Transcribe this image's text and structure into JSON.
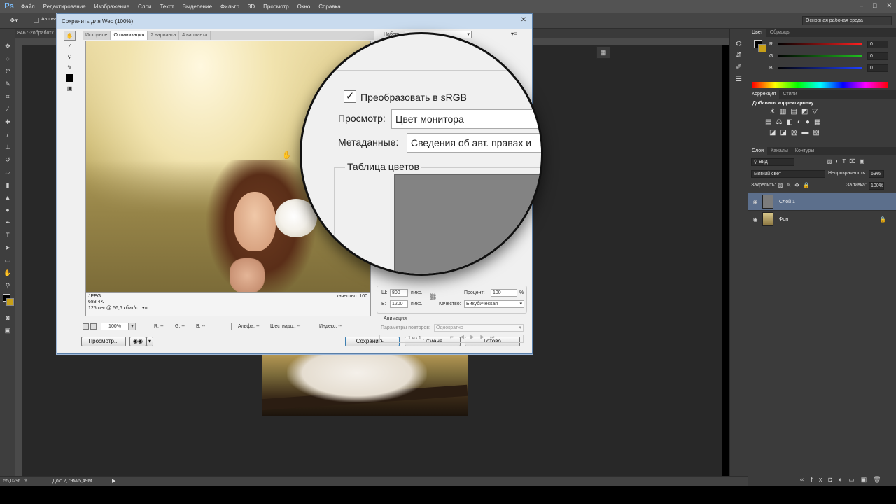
{
  "menubar": {
    "logo": "Ps",
    "items": [
      "Файл",
      "Редактирование",
      "Изображение",
      "Слои",
      "Текст",
      "Выделение",
      "Фильтр",
      "3D",
      "Просмотр",
      "Окно",
      "Справка"
    ]
  },
  "options": {
    "auto_label": "Автовы",
    "workspace": "Основная рабочая среда"
  },
  "document": {
    "tab_title": "8467-2обработк"
  },
  "statusbar": {
    "zoom": "55,02%",
    "doc_info": "Док: 2,79M/5,49M"
  },
  "dialog": {
    "title": "Сохранить для Web (100%)",
    "tabs": [
      "Исходное",
      "Оптимизация",
      "2 варианта",
      "4 варианта"
    ],
    "preview_info": {
      "format": "JPEG",
      "size": "683,4K",
      "speed": "125 сек @ 56,6 кбит/с",
      "quality": "качество: 100"
    },
    "zoom_value": "100%",
    "readouts": {
      "r": "R: --",
      "g": "G: --",
      "b": "B: --",
      "alpha": "Альфа: --",
      "hex": "Шестнадц.: --",
      "index": "Индекс: --"
    },
    "preset_label": "Набор:",
    "size": {
      "w_label": "Ш:",
      "w_value": "800",
      "h_label": "В:",
      "h_value": "1200",
      "unit": "пикс.",
      "percent_label": "Процент:",
      "percent_value": "100",
      "percent_sign": "%",
      "quality_label": "Качество:",
      "quality_value": "Бикубическая"
    },
    "animation": {
      "section": "Анимация",
      "repeat_label": "Параметры повторов:",
      "repeat_value": "Однократно",
      "frame": "1 из 1"
    },
    "buttons": {
      "preview": "Просмотр...",
      "save": "Сохранить...",
      "cancel": "Отмена",
      "done": "Готово"
    }
  },
  "magnifier": {
    "convert_label": "Преобразовать в sRGB",
    "view_label": "Просмотр:",
    "view_value": "Цвет монитора",
    "meta_label": "Метаданные:",
    "meta_value": "Сведения об авт. правах и",
    "color_table": "Таблица цветов"
  },
  "panels": {
    "color_tabs": [
      "Цвет",
      "Образцы"
    ],
    "channels": [
      {
        "label": "R",
        "value": "0",
        "color": "#ff2020"
      },
      {
        "label": "G",
        "value": "0",
        "color": "#20c020"
      },
      {
        "label": "B",
        "value": "0",
        "color": "#2040ff"
      }
    ],
    "adjust_tabs": [
      "Коррекция",
      "Стили"
    ],
    "adjust_title": "Добавить корректировку",
    "layers_tabs": [
      "Слои",
      "Каналы",
      "Контуры"
    ],
    "filter_kind": "Вид",
    "blend_mode": "Мягкий свет",
    "opacity_label": "Непрозрачность:",
    "opacity_value": "63%",
    "lock_label": "Закрепить:",
    "fill_label": "Заливка:",
    "fill_value": "100%",
    "layers": [
      {
        "name": "Слой 1",
        "selected": true
      },
      {
        "name": "Фон",
        "selected": false
      }
    ]
  },
  "colors": {
    "accent": "#5c6f8c",
    "dialog_title": "#c9dbee"
  }
}
